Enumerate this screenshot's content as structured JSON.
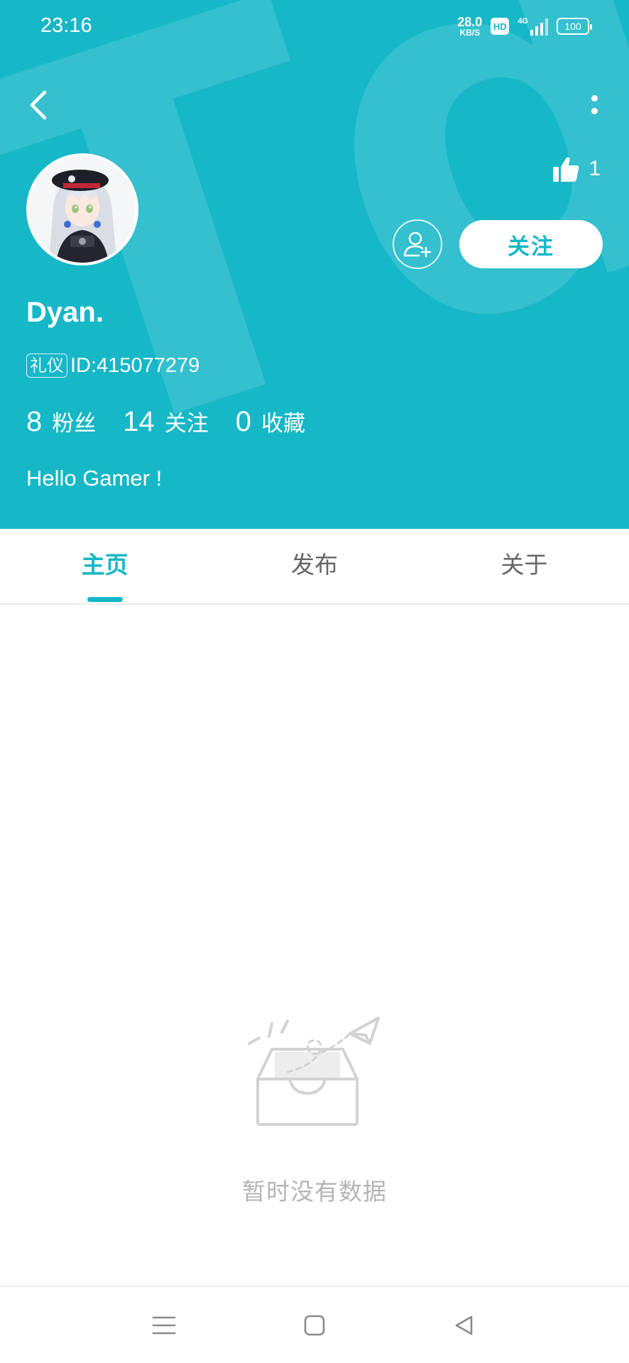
{
  "status_bar": {
    "time": "23:16",
    "net_speed_value": "28.0",
    "net_speed_unit": "KB/S",
    "hd": "HD",
    "network": "4G",
    "battery": "100"
  },
  "header": {
    "watermark_text": "apTd",
    "like_count": "1",
    "follow_label": "关注",
    "username": "Dyan.",
    "badge": "礼仪",
    "user_id": "ID:415077279",
    "stats": [
      {
        "count": "8",
        "label": "粉丝"
      },
      {
        "count": "14",
        "label": "关注"
      },
      {
        "count": "0",
        "label": "收藏"
      }
    ],
    "bio": "Hello Gamer !"
  },
  "tabs": [
    {
      "label": "主页",
      "active": true
    },
    {
      "label": "发布",
      "active": false
    },
    {
      "label": "关于",
      "active": false
    }
  ],
  "empty_state": {
    "message": "暂时没有数据",
    "icon": "empty-inbox-icon"
  },
  "colors": {
    "accent": "#16b7c7",
    "muted_text": "#b5b5b5"
  }
}
